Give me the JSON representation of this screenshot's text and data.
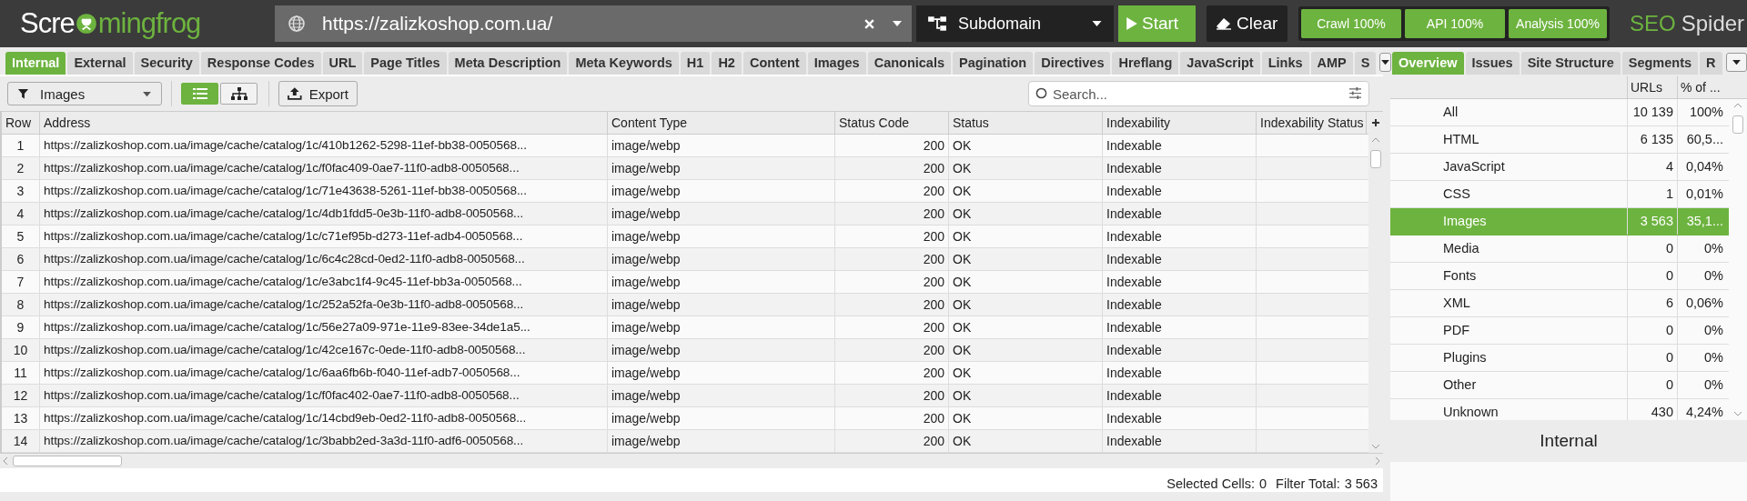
{
  "logo": {
    "before": "Scre",
    "after": "mingfrog"
  },
  "url_field": {
    "value": "https://zalizkoshop.com.ua/"
  },
  "mode_dropdown": {
    "value": "Subdomain"
  },
  "start_button": "Start",
  "clear_button": "Clear",
  "progress": [
    {
      "label": "Crawl 100%",
      "level": 1
    },
    {
      "label": "API 100%",
      "level": 1
    },
    {
      "label": "Analysis 100%",
      "level": 1
    }
  ],
  "brand": {
    "first": "SEO",
    "second": "Spider"
  },
  "tabs": [
    {
      "label": "Internal",
      "selected": true
    },
    {
      "label": "External",
      "selected": false
    },
    {
      "label": "Security",
      "selected": false
    },
    {
      "label": "Response Codes",
      "selected": false
    },
    {
      "label": "URL",
      "selected": false
    },
    {
      "label": "Page Titles",
      "selected": false
    },
    {
      "label": "Meta Description",
      "selected": false
    },
    {
      "label": "Meta Keywords",
      "selected": false
    },
    {
      "label": "H1",
      "selected": false
    },
    {
      "label": "H2",
      "selected": false
    },
    {
      "label": "Content",
      "selected": false
    },
    {
      "label": "Images",
      "selected": false
    },
    {
      "label": "Canonicals",
      "selected": false
    },
    {
      "label": "Pagination",
      "selected": false
    },
    {
      "label": "Directives",
      "selected": false
    },
    {
      "label": "Hreflang",
      "selected": false
    },
    {
      "label": "JavaScript",
      "selected": false
    },
    {
      "label": "Links",
      "selected": false
    },
    {
      "label": "AMP",
      "selected": false
    },
    {
      "label": "S",
      "selected": false
    }
  ],
  "toolbar": {
    "filter": "Images",
    "views": [
      {
        "kind": "list",
        "selected": true
      },
      {
        "kind": "tree",
        "selected": false
      }
    ],
    "export": "Export",
    "search_placeholder": "Search..."
  },
  "table": {
    "columns": [
      "Row",
      "Address",
      "Content Type",
      "Status Code",
      "Status",
      "Indexability",
      "Indexability Status"
    ],
    "rows": [
      [
        "1",
        "https://zalizkoshop.com.ua/image/cache/catalog/1c/410b1262-5298-11ef-bb38-0050568...",
        "image/webp",
        "200",
        "OK",
        "Indexable"
      ],
      [
        "2",
        "https://zalizkoshop.com.ua/image/cache/catalog/1c/f0fac409-0ae7-11f0-adb8-0050568...",
        "image/webp",
        "200",
        "OK",
        "Indexable"
      ],
      [
        "3",
        "https://zalizkoshop.com.ua/image/cache/catalog/1c/71e43638-5261-11ef-bb38-0050568...",
        "image/webp",
        "200",
        "OK",
        "Indexable"
      ],
      [
        "4",
        "https://zalizkoshop.com.ua/image/cache/catalog/1c/4db1fdd5-0e3b-11f0-adb8-0050568...",
        "image/webp",
        "200",
        "OK",
        "Indexable"
      ],
      [
        "5",
        "https://zalizkoshop.com.ua/image/cache/catalog/1c/c71ef95b-d273-11ef-adb4-0050568...",
        "image/webp",
        "200",
        "OK",
        "Indexable"
      ],
      [
        "6",
        "https://zalizkoshop.com.ua/image/cache/catalog/1c/6c4c28cd-0ed2-11f0-adb8-0050568...",
        "image/webp",
        "200",
        "OK",
        "Indexable"
      ],
      [
        "7",
        "https://zalizkoshop.com.ua/image/cache/catalog/1c/e3abc1f4-9c45-11ef-bb3a-0050568...",
        "image/webp",
        "200",
        "OK",
        "Indexable"
      ],
      [
        "8",
        "https://zalizkoshop.com.ua/image/cache/catalog/1c/252a52fa-0e3b-11f0-adb8-0050568...",
        "image/webp",
        "200",
        "OK",
        "Indexable"
      ],
      [
        "9",
        "https://zalizkoshop.com.ua/image/cache/catalog/1c/56e27a09-971e-11e9-83ee-34de1a5...",
        "image/webp",
        "200",
        "OK",
        "Indexable"
      ],
      [
        "10",
        "https://zalizkoshop.com.ua/image/cache/catalog/1c/42ce167c-0ede-11f0-adb8-0050568...",
        "image/webp",
        "200",
        "OK",
        "Indexable"
      ],
      [
        "11",
        "https://zalizkoshop.com.ua/image/cache/catalog/1c/6aa6fb6b-f040-11ef-adb7-0050568...",
        "image/webp",
        "200",
        "OK",
        "Indexable"
      ],
      [
        "12",
        "https://zalizkoshop.com.ua/image/cache/catalog/1c/f0fac402-0ae7-11f0-adb8-0050568...",
        "image/webp",
        "200",
        "OK",
        "Indexable"
      ],
      [
        "13",
        "https://zalizkoshop.com.ua/image/cache/catalog/1c/14cbd9eb-0ed2-11f0-adb8-0050568...",
        "image/webp",
        "200",
        "OK",
        "Indexable"
      ],
      [
        "14",
        "https://zalizkoshop.com.ua/image/cache/catalog/1c/3babb2ed-3a3d-11f0-adf6-0050568...",
        "image/webp",
        "200",
        "OK",
        "Indexable"
      ]
    ]
  },
  "status_bar": {
    "selected_label": "Selected Cells:",
    "selected_value": "0",
    "total_label": "Filter Total:",
    "total_value": "3 563"
  },
  "side_tabs": [
    {
      "label": "Overview",
      "selected": true
    },
    {
      "label": "Issues",
      "selected": false
    },
    {
      "label": "Site Structure",
      "selected": false
    },
    {
      "label": "Segments",
      "selected": false
    },
    {
      "label": "R",
      "selected": false
    }
  ],
  "overview": {
    "columns": [
      "URLs",
      "% of ..."
    ],
    "rows": [
      {
        "label": "All",
        "urls": "10 139",
        "share": "100%",
        "selected": false
      },
      {
        "label": "HTML",
        "urls": "6 135",
        "share": "60,5...",
        "selected": false
      },
      {
        "label": "JavaScript",
        "urls": "4",
        "share": "0,04%",
        "selected": false
      },
      {
        "label": "CSS",
        "urls": "1",
        "share": "0,01%",
        "selected": false
      },
      {
        "label": "Images",
        "urls": "3 563",
        "share": "35,1...",
        "selected": true
      },
      {
        "label": "Media",
        "urls": "0",
        "share": "0%",
        "selected": false
      },
      {
        "label": "Fonts",
        "urls": "0",
        "share": "0%",
        "selected": false
      },
      {
        "label": "XML",
        "urls": "6",
        "share": "0,06%",
        "selected": false
      },
      {
        "label": "PDF",
        "urls": "0",
        "share": "0%",
        "selected": false
      },
      {
        "label": "Plugins",
        "urls": "0",
        "share": "0%",
        "selected": false
      },
      {
        "label": "Other",
        "urls": "0",
        "share": "0%",
        "selected": false
      },
      {
        "label": "Unknown",
        "urls": "430",
        "share": "4,24%",
        "selected": false
      }
    ],
    "footer_title": "Internal"
  }
}
